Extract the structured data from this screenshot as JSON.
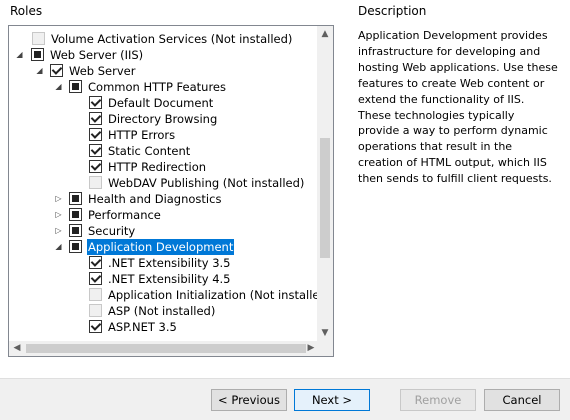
{
  "roles_heading": "Roles",
  "description_heading": "Description",
  "description_text": "Application Development provides infrastructure for developing and hosting Web applications. Use these features to create Web content or extend the functionality of IIS. These technologies typically provide a way to perform dynamic operations that result in the creation of HTML output, which IIS then sends to fulfill client requests.",
  "tree": [
    {
      "label": "Volume Activation Services (Not installed)",
      "state": "disabled",
      "expander": "none"
    },
    {
      "label": "Web Server (IIS)",
      "state": "partial",
      "expander": "expanded"
    },
    {
      "label": "Web Server",
      "state": "checked",
      "expander": "expanded"
    },
    {
      "label": "Common HTTP Features",
      "state": "partial",
      "expander": "expanded"
    },
    {
      "label": "Default Document",
      "state": "checked",
      "expander": "none"
    },
    {
      "label": "Directory Browsing",
      "state": "checked",
      "expander": "none"
    },
    {
      "label": "HTTP Errors",
      "state": "checked",
      "expander": "none"
    },
    {
      "label": "Static Content",
      "state": "checked",
      "expander": "none"
    },
    {
      "label": "HTTP Redirection",
      "state": "checked",
      "expander": "none"
    },
    {
      "label": "WebDAV Publishing (Not installed)",
      "state": "disabled",
      "expander": "none"
    },
    {
      "label": "Health and Diagnostics",
      "state": "partial",
      "expander": "collapsed"
    },
    {
      "label": "Performance",
      "state": "partial",
      "expander": "collapsed"
    },
    {
      "label": "Security",
      "state": "partial",
      "expander": "collapsed"
    },
    {
      "label": "Application Development",
      "state": "partial",
      "expander": "expanded",
      "selected": true
    },
    {
      "label": ".NET Extensibility 3.5",
      "state": "checked",
      "expander": "none"
    },
    {
      "label": ".NET Extensibility 4.5",
      "state": "checked",
      "expander": "none"
    },
    {
      "label": "Application Initialization (Not installed)",
      "state": "disabled",
      "expander": "none"
    },
    {
      "label": "ASP (Not installed)",
      "state": "disabled",
      "expander": "none"
    },
    {
      "label": "ASP.NET 3.5",
      "state": "checked",
      "expander": "none"
    }
  ],
  "buttons": {
    "previous": "< Previous",
    "next": "Next >",
    "remove": "Remove",
    "cancel": "Cancel"
  },
  "colors": {
    "selection": "#0078d7",
    "default_button_border": "#0078d7"
  }
}
